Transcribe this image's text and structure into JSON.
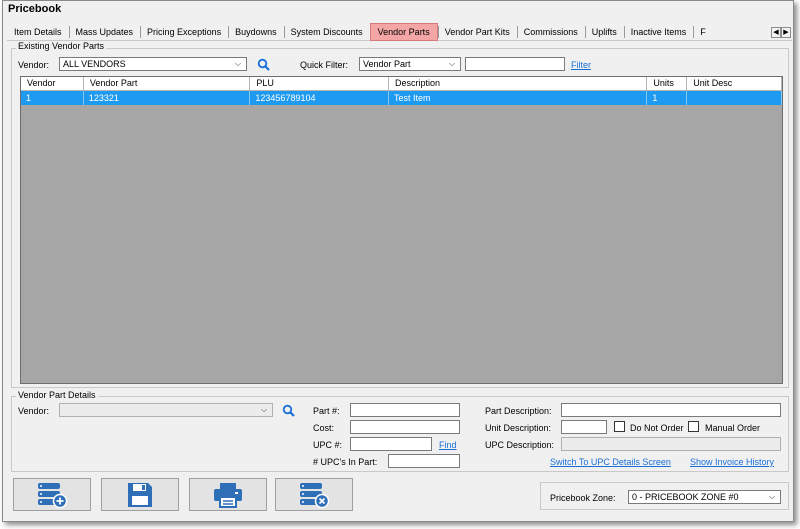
{
  "window": {
    "title": "Pricebook"
  },
  "tabs": [
    "Item Details",
    "Mass Updates",
    "Pricing Exceptions",
    "Buydowns",
    "System Discounts",
    "Vendor Parts",
    "Vendor Part Kits",
    "Commissions",
    "Uplifts",
    "Inactive Items",
    "F"
  ],
  "active_tab": "Vendor Parts",
  "existing": {
    "legend": "Existing Vendor Parts",
    "vendor_label": "Vendor:",
    "vendor_value": "ALL VENDORS",
    "quick_filter_label": "Quick Filter:",
    "quick_filter_value": "Vendor Part",
    "filter_text": "",
    "filter_link": "Filter",
    "columns": [
      "Vendor",
      "Vendor Part",
      "PLU",
      "Description",
      "Units",
      "Unit Desc"
    ],
    "rows": [
      [
        "1",
        "123321",
        "123456789104",
        "Test Item",
        "1",
        ""
      ]
    ]
  },
  "details": {
    "legend": "Vendor Part Details",
    "vendor_label": "Vendor:",
    "vendor_value": "",
    "part_label": "Part #:",
    "part_value": "",
    "cost_label": "Cost:",
    "cost_value": "",
    "upc_label": "UPC #:",
    "upc_value": "",
    "find_link": "Find",
    "upcs_in_part_label": "# UPC's In Part:",
    "upcs_in_part_value": "",
    "part_desc_label": "Part Description:",
    "part_desc_value": "",
    "unit_desc_label": "Unit Description:",
    "unit_desc_value": "",
    "do_not_order_label": "Do Not Order",
    "do_not_order_checked": false,
    "manual_order_label": "Manual Order",
    "manual_order_checked": false,
    "upc_desc_label": "UPC Description:",
    "upc_desc_value": "",
    "switch_link": "Switch To UPC Details Screen",
    "invoice_link": "Show Invoice History"
  },
  "actions": [
    "add-database-icon",
    "save-icon",
    "print-icon",
    "delete-database-icon"
  ],
  "zone": {
    "label": "Pricebook Zone:",
    "value": "0 - PRICEBOOK ZONE #0"
  },
  "colors": {
    "selected_row": "#1e9af0",
    "active_tab": "#f4a6a6",
    "icon_blue": "#2f6fb8",
    "link": "#1a6fd6"
  }
}
